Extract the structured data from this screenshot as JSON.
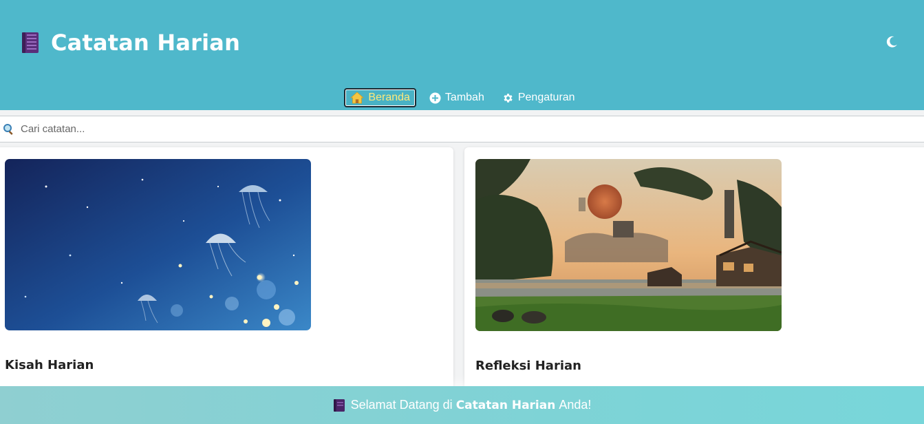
{
  "header": {
    "title": "Catatan Harian",
    "brand_icon": "book-icon",
    "theme_toggle_icon": "moon-icon"
  },
  "nav": {
    "items": [
      {
        "label": "Beranda",
        "icon": "home-icon",
        "active": true
      },
      {
        "label": "Tambah",
        "icon": "plus-circle-icon",
        "active": false
      },
      {
        "label": "Pengaturan",
        "icon": "gear-icon",
        "active": false
      }
    ]
  },
  "search": {
    "placeholder": "Cari catatan...",
    "value": ""
  },
  "cards": [
    {
      "title": "Kisah Harian",
      "image": "jellyfish-night-sky"
    },
    {
      "title": "Refleksi Harian",
      "image": "sunset-village-landscape"
    }
  ],
  "footer": {
    "prefix": "Selamat Datang di",
    "brand": "Catatan Harian",
    "suffix": "Anda!"
  },
  "colors": {
    "header_bg": "#4fb8cb",
    "active_nav_text": "#ffe97a",
    "footer_bg": "#7ed3d6"
  }
}
